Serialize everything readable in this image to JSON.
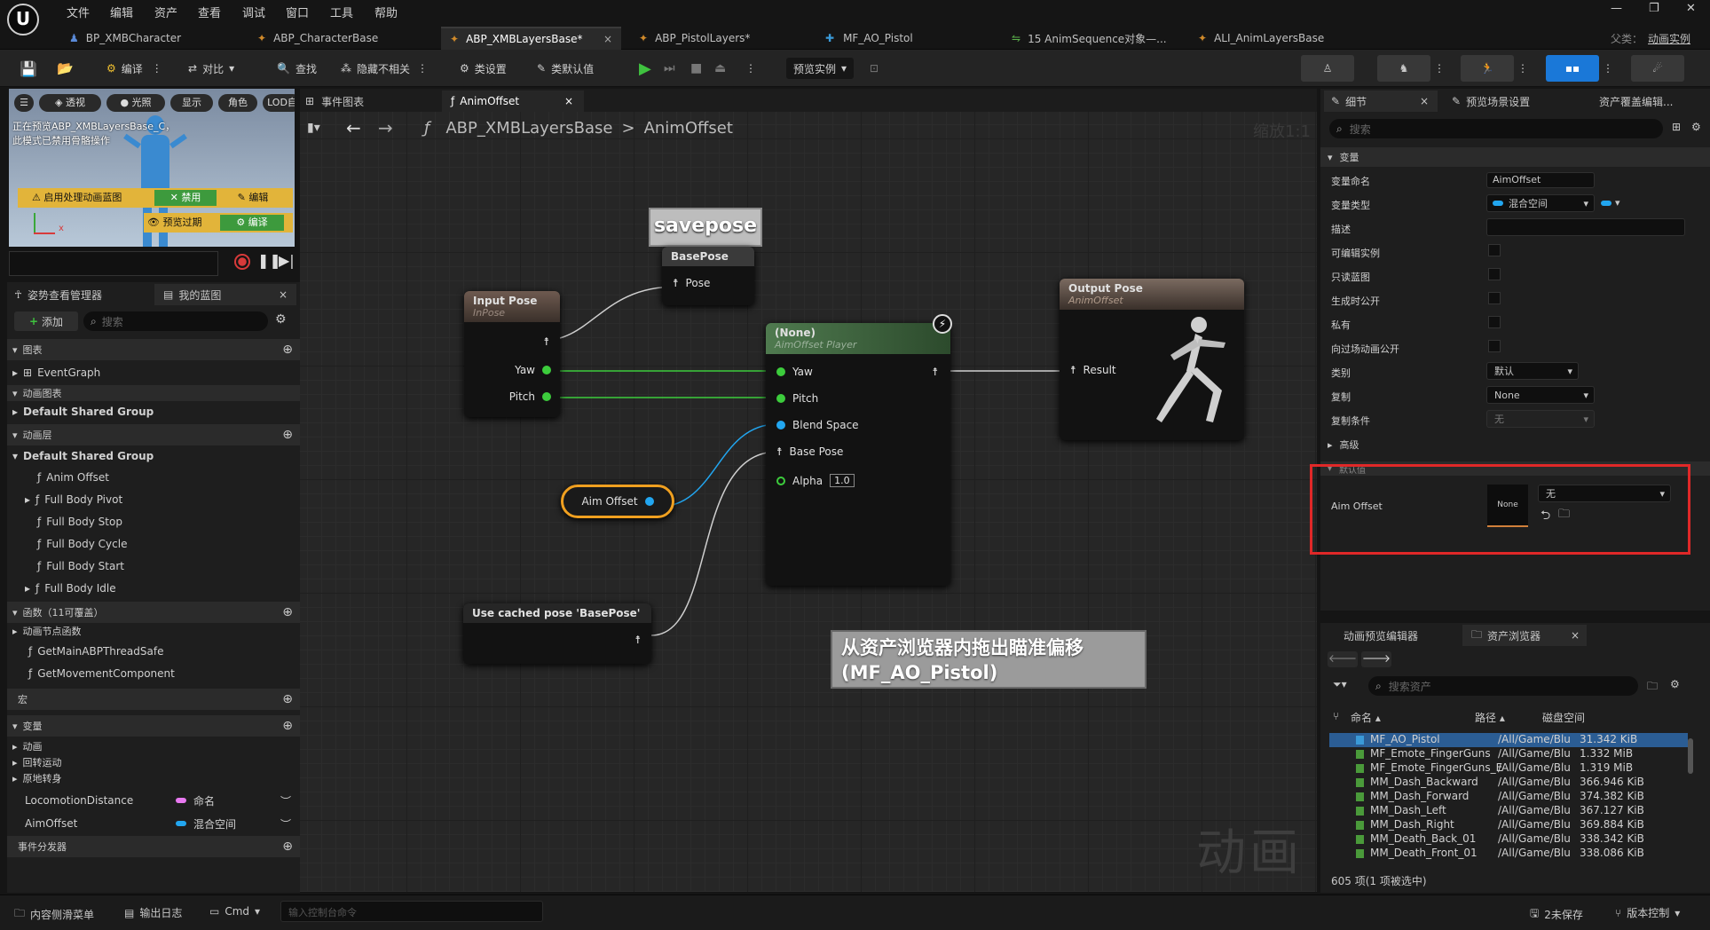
{
  "menu": [
    "文件",
    "编辑",
    "资产",
    "查看",
    "调试",
    "窗口",
    "工具",
    "帮助"
  ],
  "window_controls": {
    "min": "—",
    "max": "❐",
    "close": "✕"
  },
  "parent_class": {
    "label": "父类：",
    "value": "动画实例"
  },
  "doc_tabs": [
    {
      "label": "BP_XMBCharacter"
    },
    {
      "label": "ABP_CharacterBase"
    },
    {
      "label": "ABP_XMBLayersBase*",
      "close": "×"
    },
    {
      "label": "ABP_PistolLayers*"
    },
    {
      "label": "MF_AO_Pistol"
    },
    {
      "label": "15 AnimSequence对象—..."
    },
    {
      "label": "ALI_AnimLayersBase"
    }
  ],
  "toolbar": {
    "compile": "编译",
    "diff": "对比",
    "find": "查找",
    "hide_unrelated": "隐藏不相关",
    "class_settings": "类设置",
    "class_defaults": "类默认值",
    "preview_instance": "预览实例"
  },
  "viewport": {
    "perspective": "透视",
    "lit": "光照",
    "show": "显示",
    "character": "角色",
    "lod": "LOD自",
    "msg": "正在预览ABP_XMBLayersBase_C，\n此模式已禁用骨骼操作",
    "enable_post": "启用处理动画蓝图",
    "disable": "禁用",
    "edit": "编辑",
    "preview_pass": "预览过期",
    "compile": "编译"
  },
  "left_tabs": {
    "pose_watch": "姿势查看管理器",
    "my_bp": "我的蓝图",
    "close": "×"
  },
  "left_search": {
    "add": "添加",
    "placeholder": "搜索"
  },
  "left_tree": {
    "graphs_hdr": "图表",
    "event_graph": "EventGraph",
    "anim_graphs_hdr": "动画图表",
    "dsg1": "Default Shared Group",
    "anim_layers_hdr": "动画层",
    "dsg2": "Default Shared Group",
    "layers": [
      "Anim Offset",
      "Full Body Pivot",
      "Full Body Stop",
      "Full Body Cycle",
      "Full Body Start",
      "Full Body Idle"
    ],
    "functions_hdr": "函数（11可覆盖）",
    "anim_node_funcs": "动画节点函数",
    "funcs": [
      "GetMainABPThreadSafe",
      "GetMovementComponent"
    ],
    "macros_hdr": "宏",
    "vars_hdr": "变量",
    "var_groups": [
      "动画",
      "回转运动",
      "原地转身"
    ],
    "vars": [
      {
        "name": "LocomotionDistance",
        "type": "命名",
        "color": "#e879f0"
      },
      {
        "name": "AimOffset",
        "type": "混合空间",
        "color": "#22a6f0"
      }
    ],
    "dispatchers_hdr": "事件分发器"
  },
  "graph_tabs": {
    "event_graph": "事件图表",
    "anim_offset": "AnimOffset",
    "close": "×"
  },
  "breadcrumb": {
    "root": "ABP_XMBLayersBase",
    "sep": ">",
    "leaf": "AnimOffset"
  },
  "zoom": "缩放1:1",
  "watermark": "动画",
  "nodes": {
    "savepose": "savepose",
    "basepose_title": "BasePose",
    "basepose_pin": "Pose",
    "input_title": "Input Pose",
    "input_sub": "InPose",
    "yaw": "Yaw",
    "pitch": "Pitch",
    "player_title": "(None)",
    "player_sub": "AimOffset Player",
    "blend_space": "Blend Space",
    "base_pose": "Base Pose",
    "alpha": "Alpha",
    "alpha_val": "1.0",
    "output_title": "Output Pose",
    "output_sub": "AnimOffset",
    "result": "Result",
    "aim_var": "Aim Offset",
    "cached": "Use cached pose 'BasePose'",
    "comment": "从资产浏览器内拖出瞄准偏移\n(MF_AO_Pistol)"
  },
  "details": {
    "tab": "细节",
    "tab_close": "×",
    "preview_scene": "预览场景设置",
    "asset_override": "资产覆盖编辑...",
    "search_placeholder": "搜索",
    "section_var": "变量",
    "var_name_label": "变量命名",
    "var_name": "AimOffset",
    "var_type_label": "变量类型",
    "var_type": "混合空间",
    "desc_label": "描述",
    "checks": [
      "可编辑实例",
      "只读蓝图",
      "生成时公开",
      "私有",
      "向过场动画公开"
    ],
    "category_label": "类别",
    "category": "默认",
    "replication_label": "复制",
    "replication": "None",
    "rep_cond_label": "复制条件",
    "rep_cond": "无",
    "advanced": "高级",
    "default_hdr": "默认值",
    "default_label": "Aim Offset",
    "default_thumb": "None",
    "default_value": "无"
  },
  "asset_panel": {
    "tab1": "动画预览编辑器",
    "tab2": "资产浏览器",
    "close": "×",
    "search_placeholder": "搜索资产",
    "cols": [
      "命名",
      "路径",
      "磁盘空间"
    ],
    "rows": [
      {
        "name": "MF_AO_Pistol",
        "path": "/All/Game/Blu",
        "size": "31.342 KiB"
      },
      {
        "name": "MF_Emote_FingerGuns",
        "path": "/All/Game/Blu",
        "size": "1.332 MiB"
      },
      {
        "name": "MF_Emote_FingerGuns_Er",
        "path": "/All/Game/Blu",
        "size": "1.319 MiB"
      },
      {
        "name": "MM_Dash_Backward",
        "path": "/All/Game/Blu",
        "size": "366.946 KiB"
      },
      {
        "name": "MM_Dash_Forward",
        "path": "/All/Game/Blu",
        "size": "374.382 KiB"
      },
      {
        "name": "MM_Dash_Left",
        "path": "/All/Game/Blu",
        "size": "367.127 KiB"
      },
      {
        "name": "MM_Dash_Right",
        "path": "/All/Game/Blu",
        "size": "369.884 KiB"
      },
      {
        "name": "MM_Death_Back_01",
        "path": "/All/Game/Blu",
        "size": "338.342 KiB"
      },
      {
        "name": "MM_Death_Front_01",
        "path": "/All/Game/Blu",
        "size": "338.086 KiB"
      }
    ],
    "count": "605 项(1 项被选中)"
  },
  "statusbar": {
    "content_drawer": "内容侧滑菜单",
    "output_log": "输出日志",
    "cmd": "Cmd",
    "cmd_placeholder": "输入控制台命令",
    "unsaved": "2未保存",
    "source_control": "版本控制"
  }
}
